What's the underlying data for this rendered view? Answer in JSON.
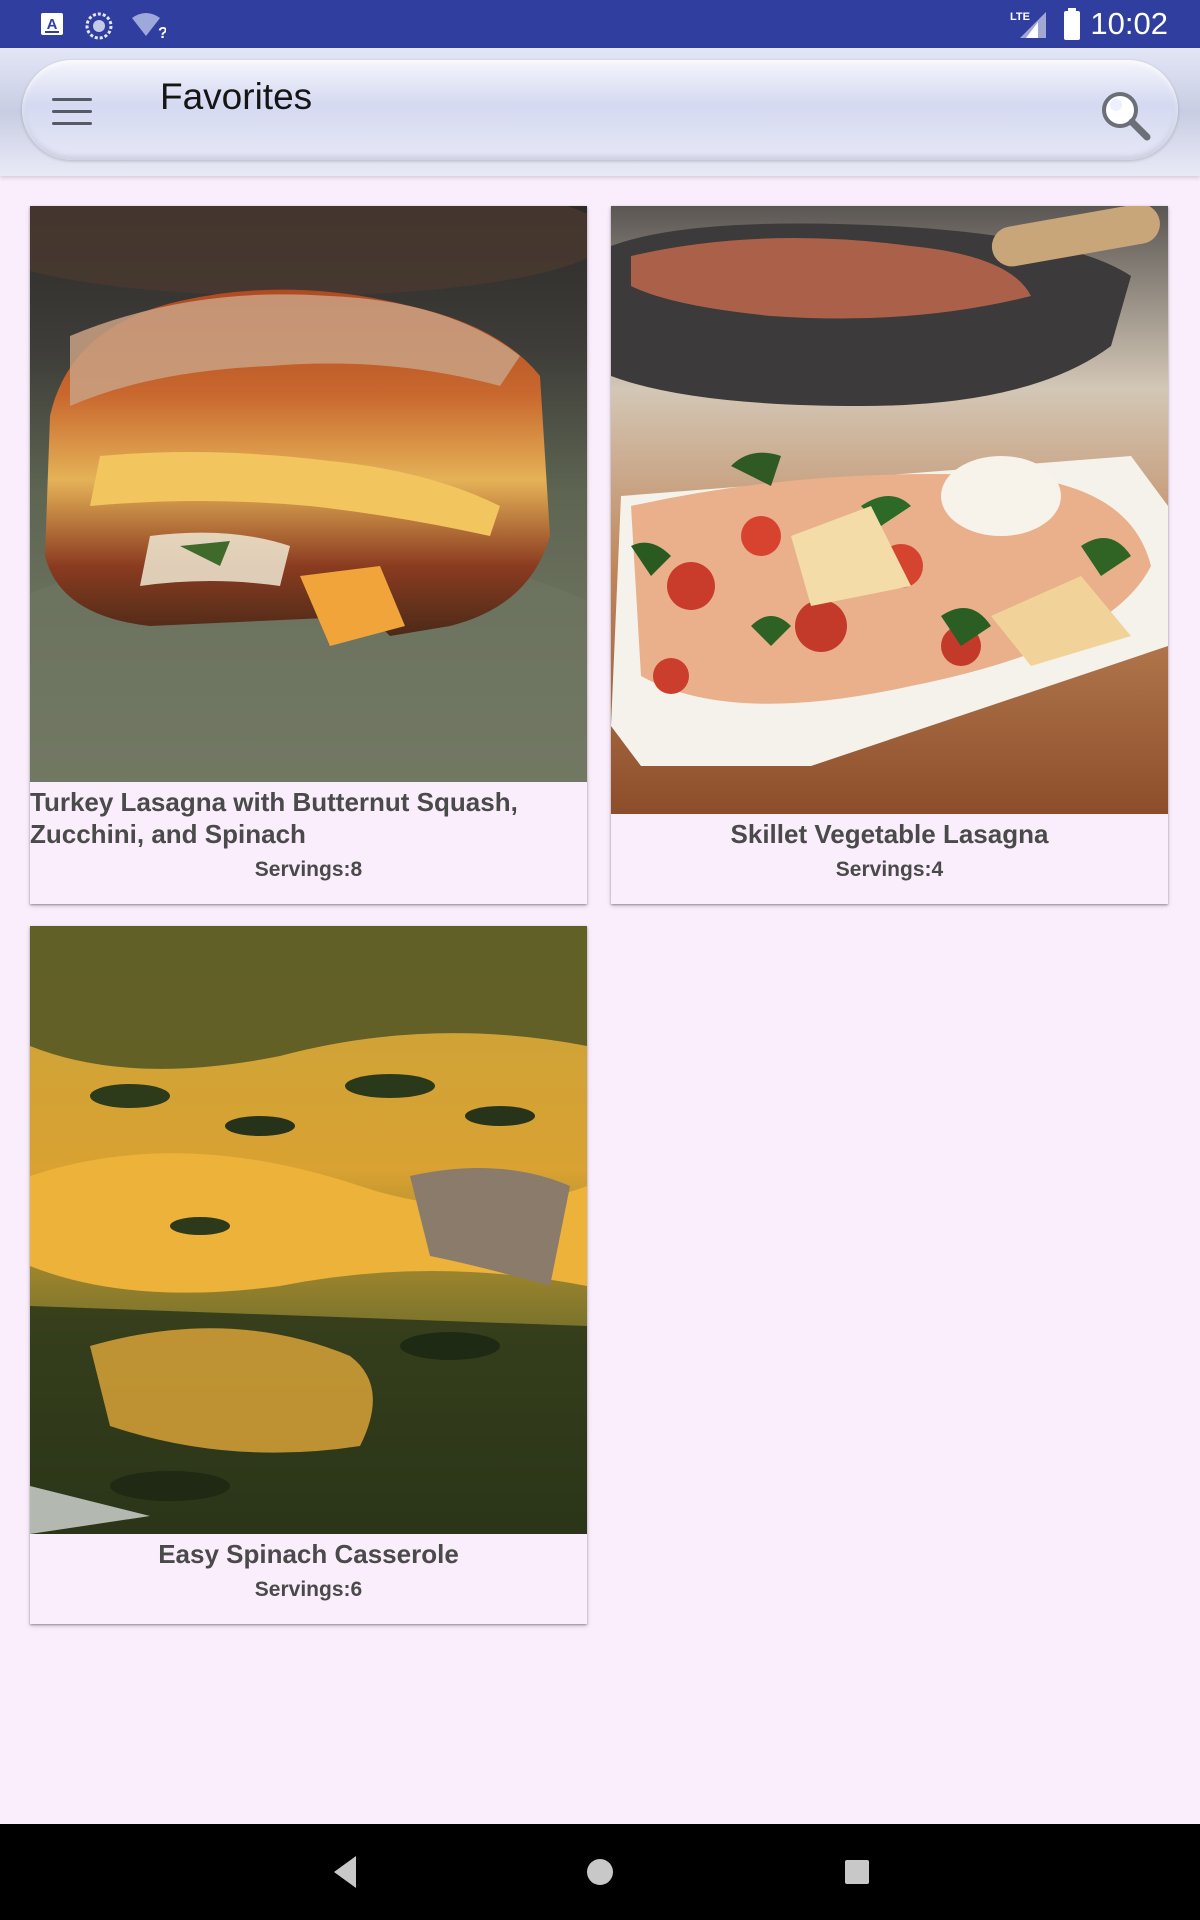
{
  "status_bar": {
    "time": "10:02",
    "network": "LTE",
    "icons": [
      "a-notification-icon",
      "sync-icon",
      "wifi-unknown-icon",
      "signal-icon",
      "battery-icon"
    ]
  },
  "app_bar": {
    "title": "Favorites",
    "menu_icon": "hamburger-menu-icon",
    "search_icon": "search-icon"
  },
  "recipes": [
    {
      "title": "Turkey Lasagna with Butternut Squash, Zucchini, and Spinach",
      "servings_label": "Servings:8",
      "image": "lasagna-butternut-photo"
    },
    {
      "title": "Skillet Vegetable Lasagna",
      "servings_label": "Servings:4",
      "image": "skillet-lasagna-photo"
    },
    {
      "title": "Easy Spinach Casserole",
      "servings_label": "Servings:6",
      "image": "spinach-casserole-photo"
    }
  ],
  "nav_bar": {
    "buttons": [
      "back-icon",
      "home-icon",
      "recents-icon"
    ]
  },
  "colors": {
    "status_bar": "#303f9f",
    "background": "#fbeefc",
    "text": "#4a4a4a"
  }
}
